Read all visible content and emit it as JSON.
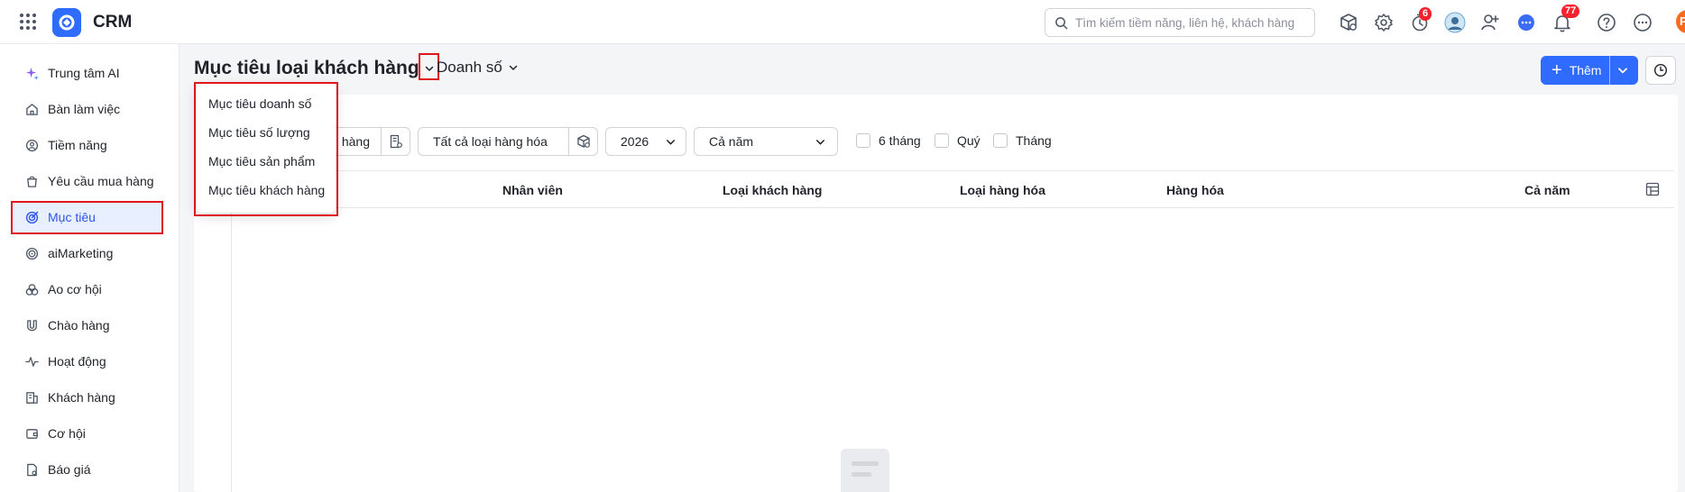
{
  "app": {
    "name": "CRM"
  },
  "search": {
    "placeholder": "Tìm kiếm tiềm năng, liên hệ, khách hàng"
  },
  "topbar": {
    "icons": [
      "package-icon",
      "settings-icon",
      "timer-icon",
      "user-avatar",
      "add-user-icon",
      "chat-icon",
      "bell-icon",
      "help-icon",
      "more-icon"
    ],
    "timer_badge": "6",
    "bell_badge": "77",
    "profile_initial": "P"
  },
  "sidebar": {
    "items": [
      {
        "label": "Trung tâm AI",
        "icon": "sparkle-icon"
      },
      {
        "label": "Bàn làm việc",
        "icon": "home-icon"
      },
      {
        "label": "Tiềm năng",
        "icon": "lead-icon"
      },
      {
        "label": "Yêu cầu mua hàng",
        "icon": "cart-icon"
      },
      {
        "label": "Mục tiêu",
        "icon": "target-icon",
        "active": true
      },
      {
        "label": "aiMarketing",
        "icon": "marketing-icon"
      },
      {
        "label": "Ao cơ hội",
        "icon": "pool-icon"
      },
      {
        "label": "Chào hàng",
        "icon": "magnet-icon"
      },
      {
        "label": "Hoạt động",
        "icon": "activity-icon"
      },
      {
        "label": "Khách hàng",
        "icon": "building-icon"
      },
      {
        "label": "Cơ hội",
        "icon": "wallet-icon"
      },
      {
        "label": "Báo giá",
        "icon": "quote-icon"
      }
    ]
  },
  "header": {
    "title": "Mục tiêu loại khách hàng",
    "sub_select": "Doanh số",
    "add_label": "Thêm"
  },
  "dropdown": {
    "items": [
      "Mục tiêu doanh số",
      "Mục tiêu số lượng",
      "Mục tiêu sản phẩm",
      "Mục tiêu khách hàng"
    ]
  },
  "filters": {
    "customer_type_partial": "hàng",
    "goods_type": "Tất cả loại hàng hóa",
    "year": "2026",
    "period": "Cả năm",
    "checkboxes": [
      "6 tháng",
      "Quý",
      "Tháng"
    ]
  },
  "table": {
    "columns": [
      "Nhân viên",
      "Loại khách hàng",
      "Loại hàng hóa",
      "Hàng hóa",
      "Cả năm"
    ]
  },
  "colors": {
    "accent": "#2f6bff",
    "highlight": "#e0161d",
    "badge": "#f5222d"
  }
}
